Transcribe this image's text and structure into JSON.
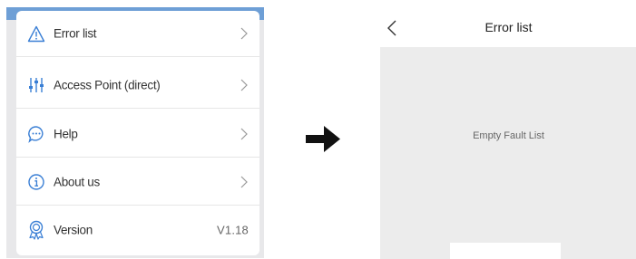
{
  "left_screen": {
    "menu": [
      {
        "label": "Error list",
        "icon": "warning-triangle-icon",
        "chevron": true
      },
      {
        "label": "Access Point (direct)",
        "icon": "sliders-icon",
        "chevron": true
      },
      {
        "label": "Help",
        "icon": "chat-bubble-icon",
        "chevron": true
      },
      {
        "label": "About us",
        "icon": "info-circle-icon",
        "chevron": true
      },
      {
        "label": "Version",
        "icon": "badge-icon",
        "value": "V1.18"
      }
    ]
  },
  "transition": {
    "icon": "right-arrow-icon"
  },
  "right_screen": {
    "header": {
      "title": "Error list",
      "back_icon": "chevron-left-icon"
    },
    "empty_message": "Empty Fault List"
  },
  "colors": {
    "accent": "#3a7fd5",
    "top_bar": "#6e9fd6",
    "divider": "#e6e6e6"
  }
}
